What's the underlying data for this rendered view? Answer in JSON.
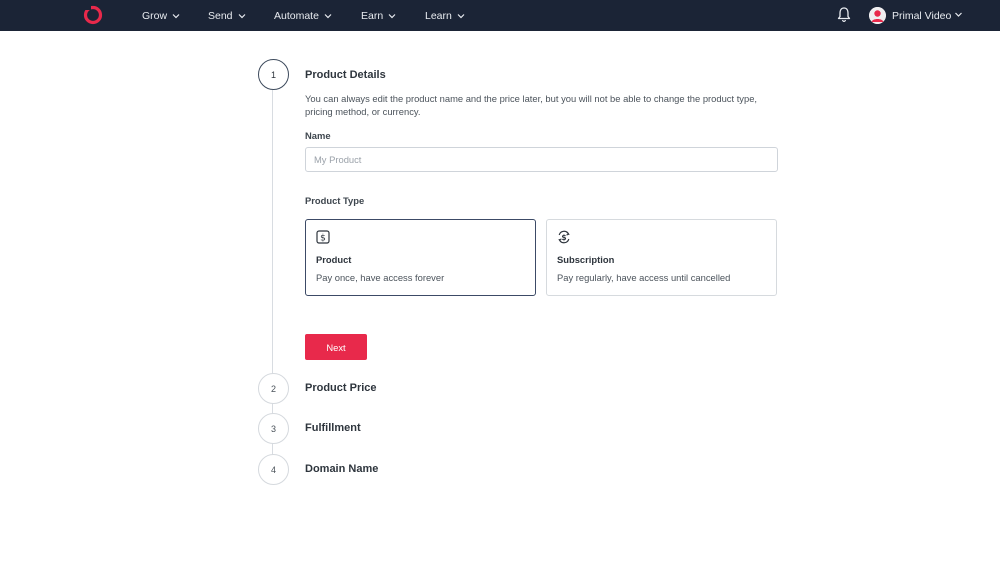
{
  "nav": {
    "items": [
      {
        "label": "Grow"
      },
      {
        "label": "Send"
      },
      {
        "label": "Automate"
      },
      {
        "label": "Earn"
      },
      {
        "label": "Learn"
      }
    ],
    "user_name": "Primal Video"
  },
  "steps": [
    {
      "number": "1",
      "title": "Product Details"
    },
    {
      "number": "2",
      "title": "Product Price"
    },
    {
      "number": "3",
      "title": "Fulfillment"
    },
    {
      "number": "4",
      "title": "Domain Name"
    }
  ],
  "details": {
    "description": "You can always edit the product name and the price later, but you will not be able to change the product type, pricing method, or currency.",
    "name_label": "Name",
    "name_value": "",
    "name_placeholder": "My Product",
    "type_label": "Product Type",
    "types": [
      {
        "title": "Product",
        "subtitle": "Pay once, have access forever",
        "selected": true
      },
      {
        "title": "Subscription",
        "subtitle": "Pay regularly, have access until cancelled",
        "selected": false
      }
    ],
    "next_label": "Next"
  },
  "colors": {
    "nav_bg": "#1b2436",
    "brand": "#e8294b",
    "selected_border": "#3c4a66"
  }
}
